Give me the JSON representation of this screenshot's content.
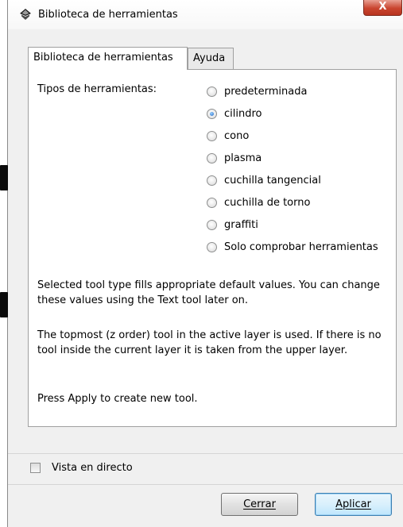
{
  "window": {
    "title": "Biblioteca de herramientas",
    "close_label": "X"
  },
  "tabs": [
    {
      "label": "Biblioteca de herramientas",
      "active": true
    },
    {
      "label": "Ayuda",
      "active": false
    }
  ],
  "tool_types": {
    "label": "Tipos de herramientas:",
    "options": [
      {
        "label": "predeterminada",
        "checked": false
      },
      {
        "label": "cilindro",
        "checked": true
      },
      {
        "label": "cono",
        "checked": false
      },
      {
        "label": "plasma",
        "checked": false
      },
      {
        "label": "cuchilla tangencial",
        "checked": false
      },
      {
        "label": "cuchilla de torno",
        "checked": false
      },
      {
        "label": "graffiti",
        "checked": false
      },
      {
        "label": "Solo comprobar herramientas",
        "checked": false
      }
    ]
  },
  "description": [
    "Selected tool type fills appropriate default values. You can change these values using the Text tool later on.",
    "The topmost (z order) tool in the active layer is used. If there is no tool inside the current layer it is taken from the upper layer.",
    "Press Apply to create new tool."
  ],
  "live_preview": {
    "label": "Vista en directo",
    "checked": false
  },
  "buttons": {
    "close": "Cerrar",
    "apply": "Aplicar"
  }
}
